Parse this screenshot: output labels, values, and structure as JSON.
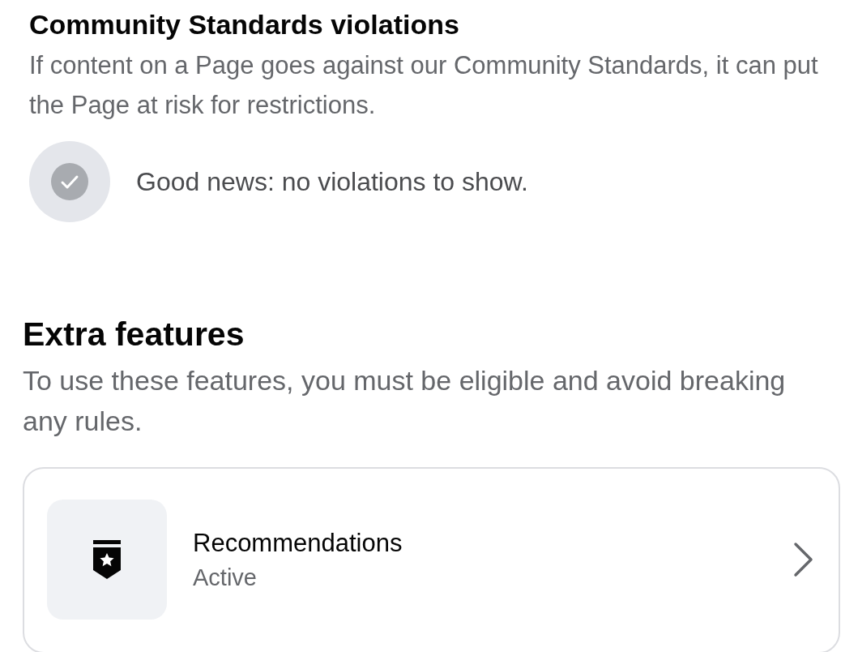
{
  "violations": {
    "title": "Community Standards violations",
    "description": "If content on a Page goes against our Community Standards, it can put the Page at risk for restrictions.",
    "status": "Good news: no violations to show."
  },
  "extra_features": {
    "title": "Extra features",
    "description": "To use these features, you must be eligible and avoid breaking any rules.",
    "items": [
      {
        "name": "Recommendations",
        "status": "Active"
      }
    ]
  }
}
